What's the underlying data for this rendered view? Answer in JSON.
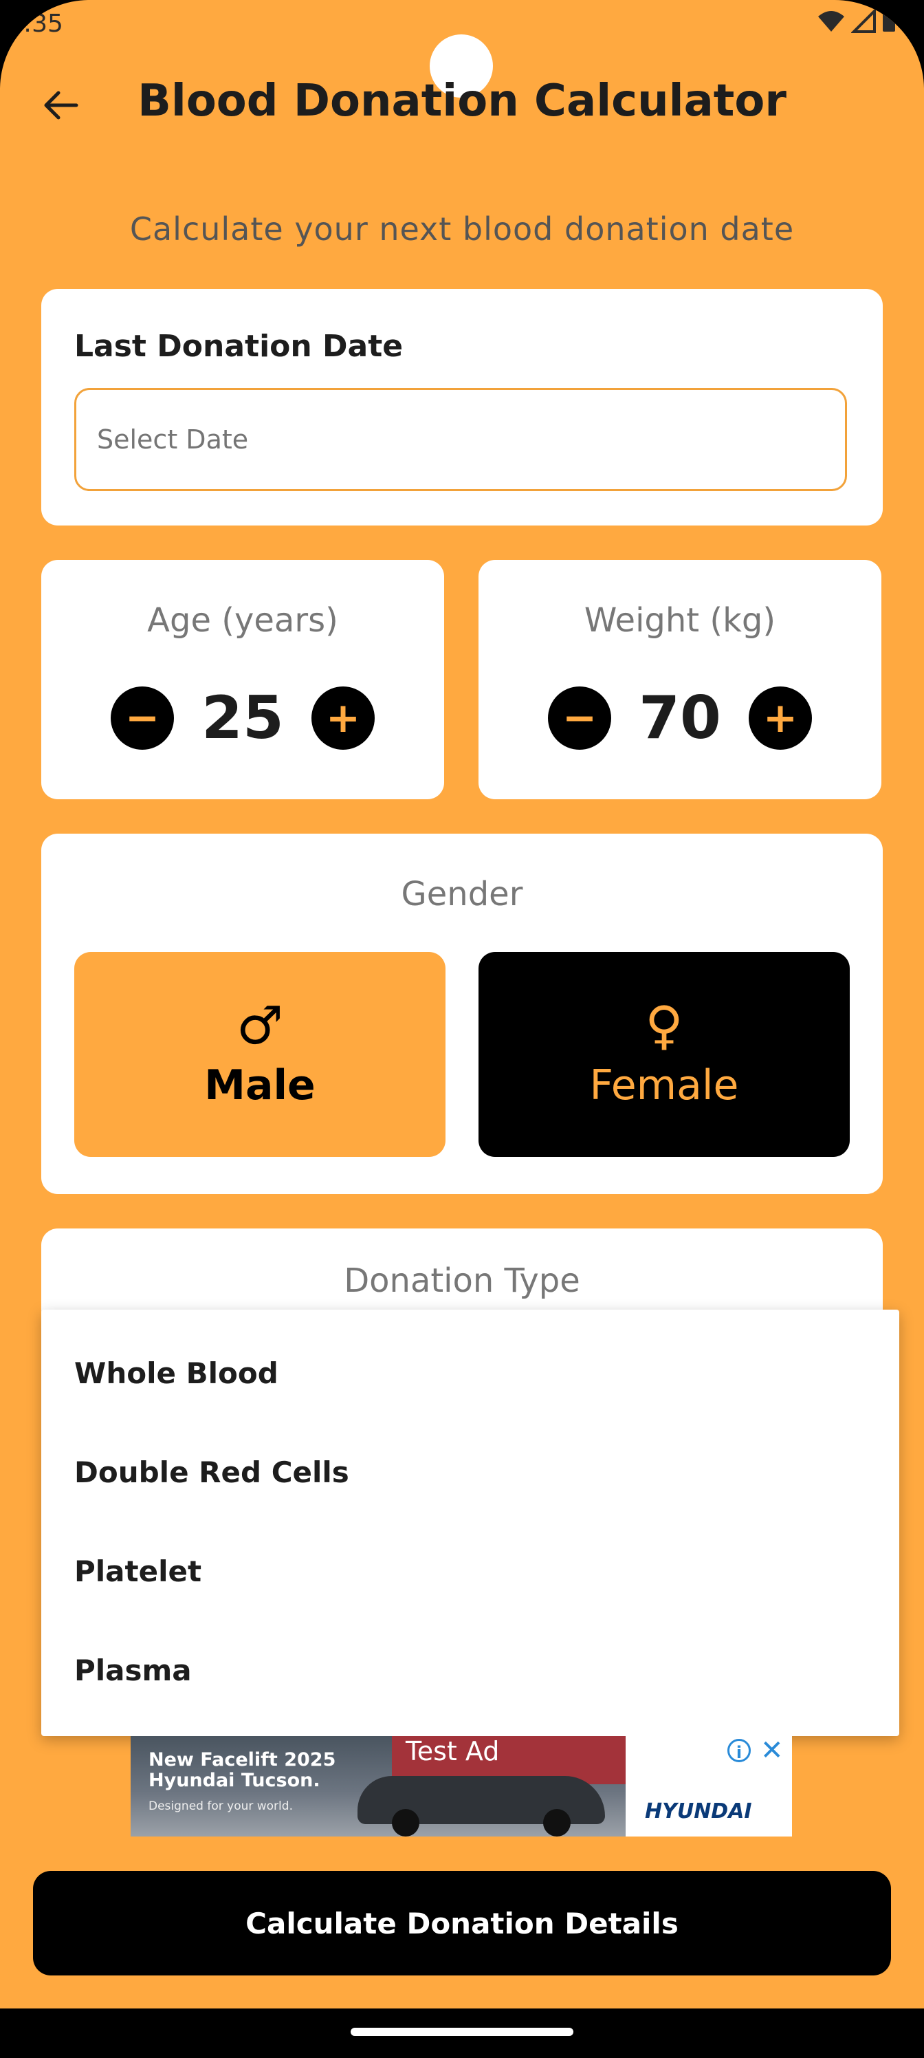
{
  "status_bar": {
    "time": ":35"
  },
  "header": {
    "title": "Blood Donation Calculator"
  },
  "subtitle": "Calculate your next blood donation date",
  "last_donation": {
    "label": "Last Donation Date",
    "placeholder": "Select Date",
    "value": ""
  },
  "age": {
    "label": "Age (years)",
    "value": "25",
    "minus": "−",
    "plus": "+"
  },
  "weight": {
    "label": "Weight (kg)",
    "value": "70",
    "minus": "−",
    "plus": "+"
  },
  "gender": {
    "label": "Gender",
    "male": {
      "label": "Male",
      "icon": "♂"
    },
    "female": {
      "label": "Female",
      "icon": "♀"
    },
    "selected": "Male"
  },
  "donation_type": {
    "label": "Donation Type",
    "options": [
      "Whole Blood",
      "Double Red Cells",
      "Platelet",
      "Plasma"
    ]
  },
  "ad": {
    "headline_line1": "New Facelift 2025",
    "headline_line2": "Hyundai Tucson.",
    "tagline": "Designed for your world.",
    "test_label": "Test Ad",
    "info": "i",
    "close": "✕",
    "brand": "HYUNDAI"
  },
  "calculate_button": "Calculate Donation Details",
  "colors": {
    "accent": "#FFA940",
    "dark": "#000000",
    "card": "#FFFFFF"
  }
}
